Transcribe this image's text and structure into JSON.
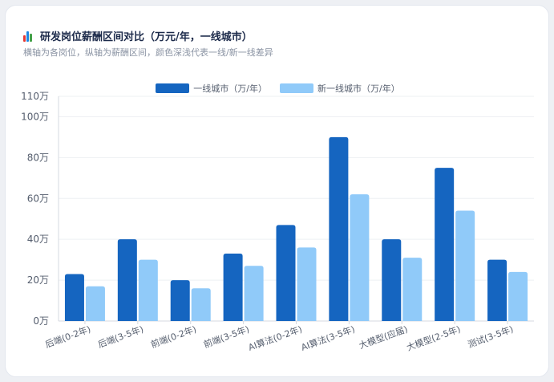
{
  "header": {
    "icon": "bar-chart-icon",
    "title": "研发岗位薪酬区间对比（万元/年，一线城市）",
    "subtitle": "横轴为各岗位，纵轴为薪酬区间，颜色深浅代表一线/新一线差异"
  },
  "colors": {
    "series_dark": "#1565c0",
    "series_light": "#90caf9",
    "grid": "#eef0f3",
    "axis_text": "#555e6e"
  },
  "chart_data": {
    "type": "bar",
    "categories": [
      "后端(0-2年)",
      "后端(3-5年)",
      "前端(0-2年)",
      "前端(3-5年)",
      "AI算法(0-2年)",
      "AI算法(3-5年)",
      "大模型(应届)",
      "大模型(2-5年)",
      "测试(3-5年)"
    ],
    "series": [
      {
        "name": "一线城市（万/年）",
        "values": [
          23,
          40,
          20,
          33,
          47,
          90,
          40,
          75,
          30
        ]
      },
      {
        "name": "新一线城市（万/年）",
        "values": [
          17,
          30,
          16,
          27,
          36,
          62,
          31,
          54,
          24
        ]
      }
    ],
    "ylim": [
      0,
      110
    ],
    "yticks": [
      0,
      20,
      40,
      60,
      80,
      100,
      110
    ],
    "ytick_labels": [
      "0万",
      "20万",
      "40万",
      "60万",
      "80万",
      "100万",
      "110万"
    ],
    "grid": true,
    "legend_position": "top-center",
    "xlabel": "",
    "ylabel": ""
  }
}
